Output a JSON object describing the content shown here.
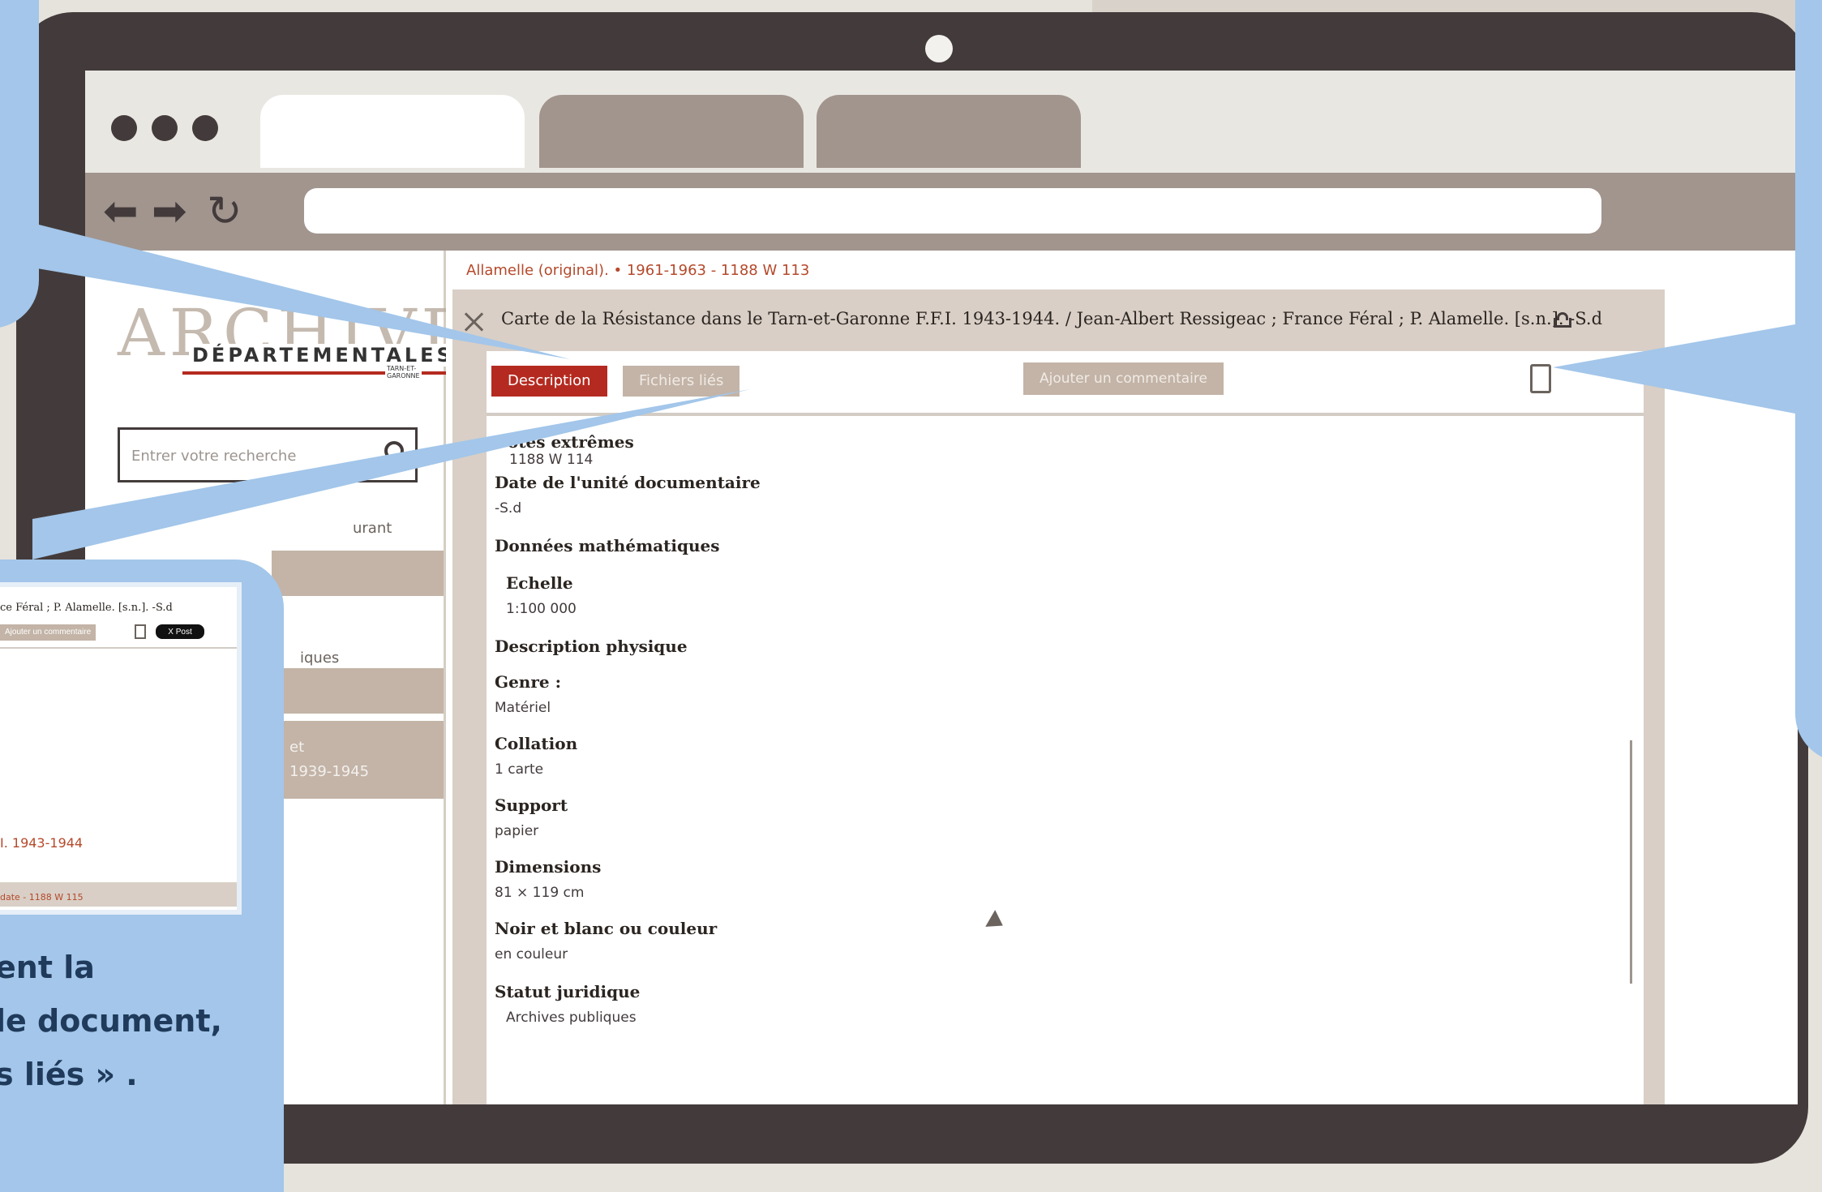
{
  "sidebar": {
    "logo_top": "ARCHIVES",
    "logo_main": "DÉPARTEMENTALES",
    "logo_region": "TARN-ET-GARONNE",
    "search_placeholder": "Entrer votre recherche",
    "fragment_1": "urant",
    "fragment_2": "iques",
    "fragment_3": "et",
    "fragment_4": "1939-1945"
  },
  "main": {
    "breadcrumb": "Allamelle (original). • 1961-1963 - 1188 W 113",
    "record_title": "Carte de la Résistance dans le Tarn-et-Garonne F.F.I. 1943-1944. / Jean-Albert Ressigeac ; France Féral ; P. Alamelle.  [s.n.]. -S.d",
    "tabs": [
      "Description",
      "Fichiers liés"
    ],
    "comment_button": "Ajouter un commentaire",
    "fields": {
      "cotes_label": "Cotes extrêmes",
      "cotes_value": "1188 W 114",
      "date_label": "Date de l'unité documentaire",
      "date_value": "-S.d",
      "math_label": "Données mathématiques",
      "echelle_label": "Echelle",
      "echelle_value": "1:100 000",
      "physique_label": "Description physique",
      "genre_label": "Genre :",
      "genre_value": "Matériel",
      "collation_label": "Collation",
      "collation_value": "1 carte",
      "support_label": "Support",
      "support_value": "papier",
      "dimensions_label": "Dimensions",
      "dimensions_value": "81 × 119 cm",
      "couleur_label": "Noir et blanc ou couleur",
      "couleur_value": "en couleur",
      "statut_label": "Statut juridique",
      "statut_value": "Archives publiques"
    }
  },
  "thumbnail": {
    "title": "ce Féral ; P. Alamelle.  [s.n.]. -S.d",
    "comment_button": "Ajouter un commentaire",
    "post_button": "X Post",
    "link": "I. 1943-1944",
    "footer": "date - 1188 W 115"
  },
  "callout": {
    "lines": [
      "ent la",
      "le document,",
      "s liés » ."
    ]
  },
  "colors": {
    "accent_red": "#b52a20",
    "tab_gray": "#c3b4a7",
    "callout_blue": "#a3c6ea",
    "frame": "#433b3b"
  }
}
